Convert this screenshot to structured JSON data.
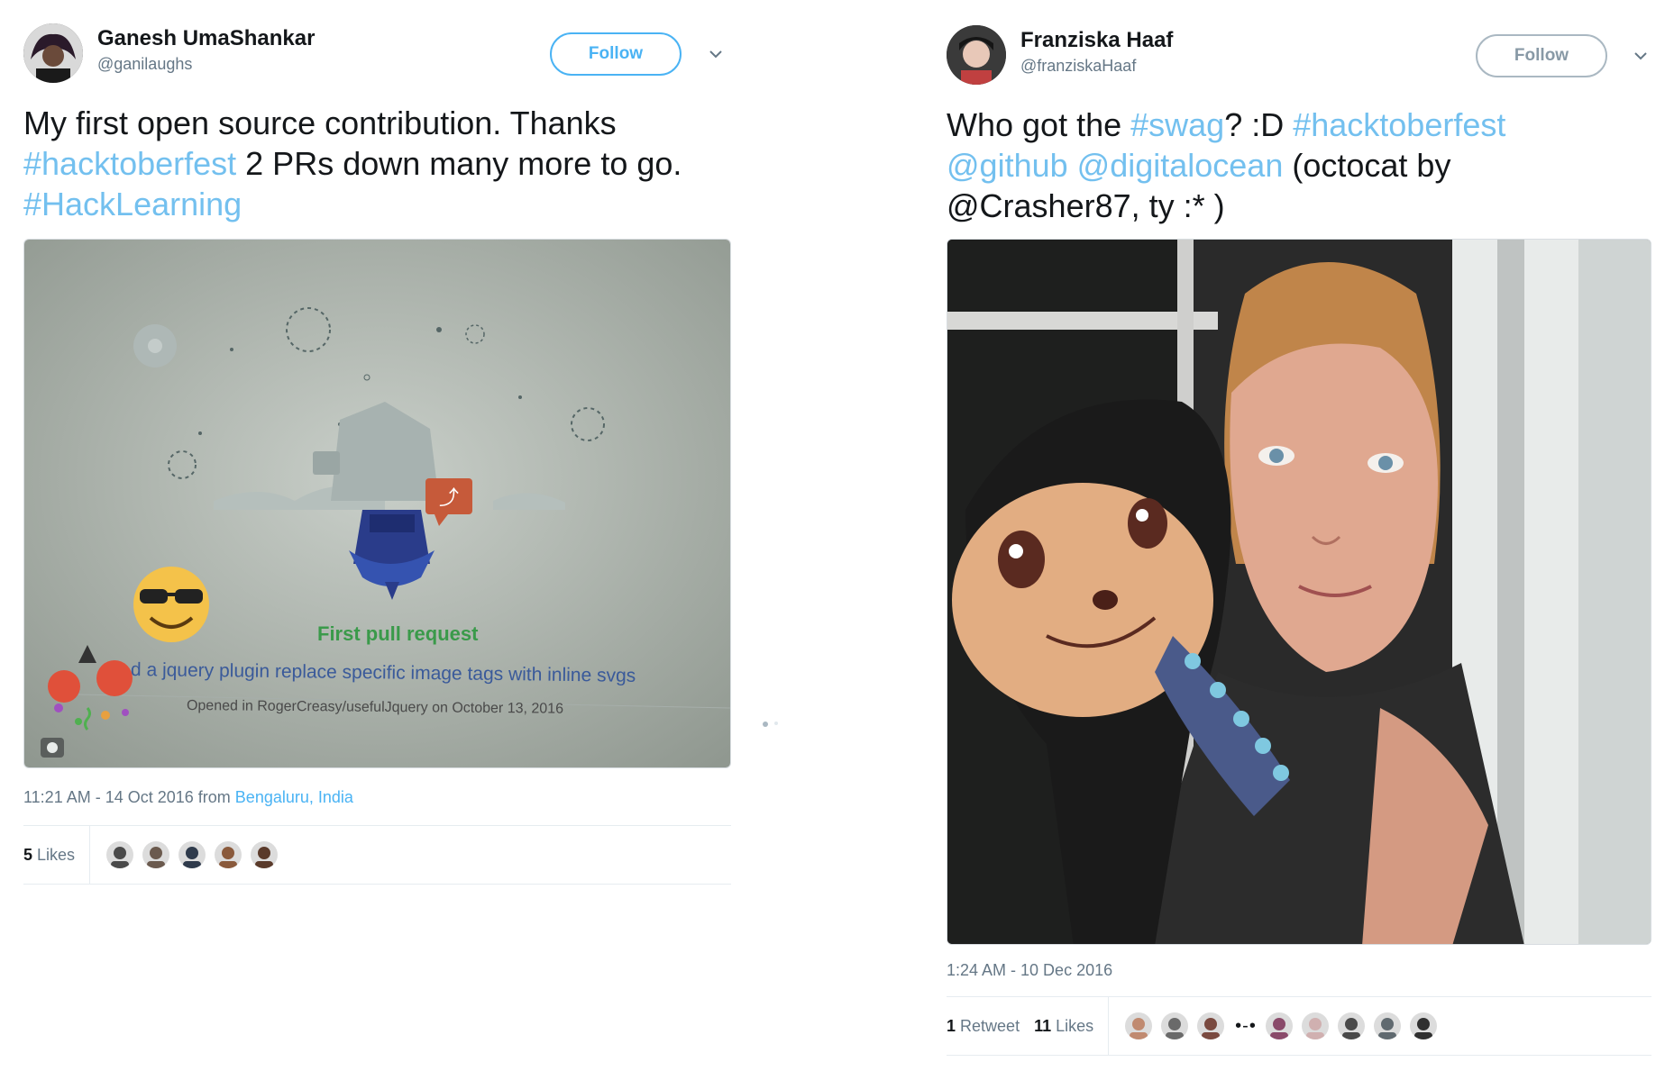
{
  "tweets": [
    {
      "name": "Ganesh UmaShankar",
      "handle": "@ganilaughs",
      "follow_label": "Follow",
      "text": [
        {
          "t": "My first open source contribution. Thanks ",
          "tag": false
        },
        {
          "t": "#hacktoberfest",
          "tag": true
        },
        {
          "t": " 2 PRs down many more to go. ",
          "tag": false
        },
        {
          "t": "#HackLearning",
          "tag": true
        }
      ],
      "photo": {
        "heading": "First pull request",
        "subtitle": "d a jquery plugin replace specific image tags with inline svgs",
        "opened": "Opened in RogerCreasy/usefulJquery on October 13, 2016"
      },
      "timestamp": "11:21 AM - 14 Oct 2016 from ",
      "location": "Bengaluru, India",
      "retweets": null,
      "likes_count": "5",
      "likes_label": "Likes",
      "liker_colors": [
        "#4a4a4a",
        "#6b5a4e",
        "#2f3b4c",
        "#8a5a3c",
        "#5a3a2a"
      ]
    },
    {
      "name": "Franziska Haaf",
      "handle": "@franziskaHaaf",
      "follow_label": "Follow",
      "text": [
        {
          "t": "Who got the ",
          "tag": false
        },
        {
          "t": "#swag",
          "tag": true
        },
        {
          "t": "? :D ",
          "tag": false
        },
        {
          "t": "#hacktoberfest",
          "tag": true
        },
        {
          "t": " ",
          "tag": false
        },
        {
          "t": "@github",
          "tag": true
        },
        {
          "t": " ",
          "tag": false
        },
        {
          "t": "@digitalocean",
          "tag": true
        },
        {
          "t": " (octocat by @Crasher87, ty :* )",
          "tag": false
        }
      ],
      "timestamp": "1:24 AM - 10 Dec 2016",
      "location": "",
      "retweets_count": "1",
      "retweets_label": "Retweet",
      "likes_count": "11",
      "likes_label": "Likes",
      "liker_colors_a": [
        "#c08a70",
        "#6a6a6a",
        "#7a4a40"
      ],
      "more_dots": "•-•",
      "liker_colors_b": [
        "#8a4a6a",
        "#d0b0b0",
        "#4a4a4a",
        "#606a70",
        "#303030"
      ]
    }
  ],
  "colors": {
    "accent": "#4ab3f4",
    "hashtag": "#73c0ef",
    "muted": "#657786"
  }
}
